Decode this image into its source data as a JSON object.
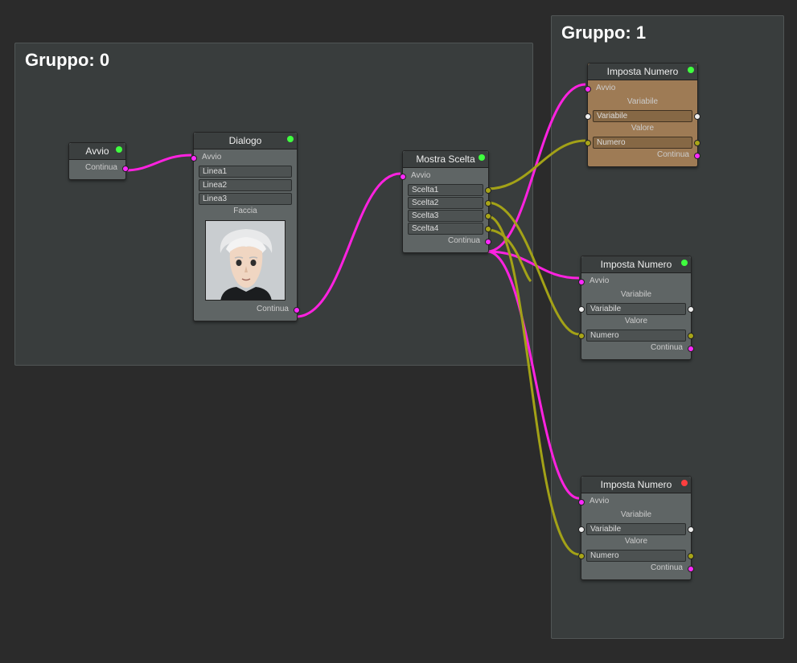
{
  "groups": [
    {
      "title": "Gruppo: 0"
    },
    {
      "title": "Gruppo: 1"
    }
  ],
  "nodes": {
    "avvio": {
      "title": "Avvio",
      "continua": "Continua"
    },
    "dialogo": {
      "title": "Dialogo",
      "avvio": "Avvio",
      "linea1": "Linea1",
      "linea2": "Linea2",
      "linea3": "Linea3",
      "faccia": "Faccia",
      "continua": "Continua"
    },
    "scelta": {
      "title": "Mostra Scelta",
      "avvio": "Avvio",
      "s1": "Scelta1",
      "s2": "Scelta2",
      "s3": "Scelta3",
      "s4": "Scelta4",
      "continua": "Continua"
    },
    "imposta": {
      "title": "Imposta Numero",
      "avvio": "Avvio",
      "variabile_label": "Variabile",
      "variabile_field": "Variabile",
      "valore_label": "Valore",
      "numero_field": "Numero",
      "continua": "Continua"
    }
  }
}
